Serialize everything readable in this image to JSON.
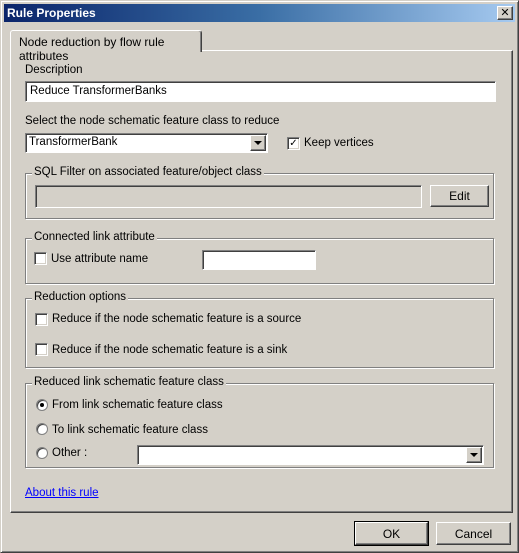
{
  "window": {
    "title": "Rule Properties",
    "close_icon": "close-icon"
  },
  "tabs": [
    {
      "label": "Node reduction by flow rule attributes",
      "active": true
    }
  ],
  "description": {
    "label": "Description",
    "value": "Reduce TransformerBanks"
  },
  "feature_class": {
    "label": "Select the node schematic feature class to reduce",
    "selected": "TransformerBank",
    "keep_vertices_label": "Keep vertices",
    "keep_vertices_checked": true
  },
  "sql_filter": {
    "group_label": "SQL Filter on associated feature/object class",
    "value": "",
    "edit_label": "Edit"
  },
  "connected_link": {
    "group_label": "Connected link attribute",
    "use_attribute_label": "Use attribute name",
    "use_attribute_checked": false,
    "attribute_value": ""
  },
  "reduction_options": {
    "group_label": "Reduction options",
    "source_label": "Reduce if the node schematic feature is a source",
    "source_checked": false,
    "sink_label": "Reduce if the node schematic feature is a sink",
    "sink_checked": false
  },
  "reduced_link": {
    "group_label": "Reduced link schematic feature class",
    "options": [
      {
        "label": "From link schematic feature class",
        "selected": true
      },
      {
        "label": "To link schematic feature class",
        "selected": false
      },
      {
        "label": "Other :",
        "selected": false
      }
    ],
    "other_value": ""
  },
  "about_link": "About this rule",
  "footer": {
    "ok_label": "OK",
    "cancel_label": "Cancel"
  }
}
